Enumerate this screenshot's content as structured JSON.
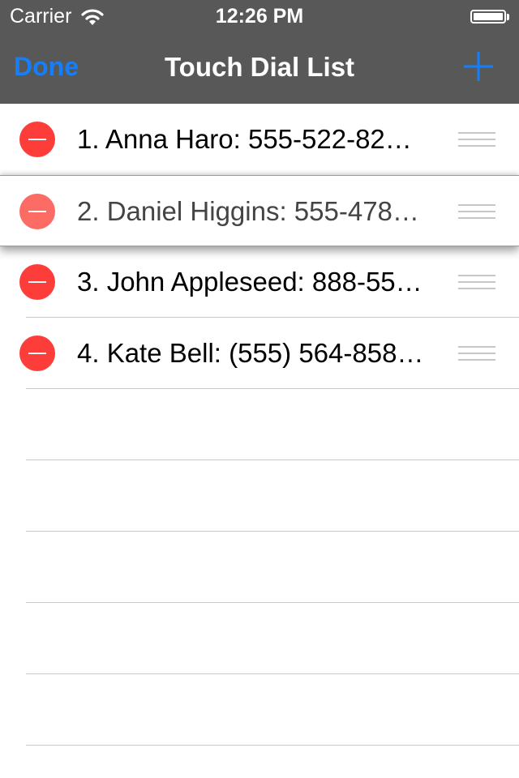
{
  "status_bar": {
    "carrier": "Carrier",
    "time": "12:26 PM",
    "wifi_icon": "wifi-icon",
    "battery_icon": "battery-icon"
  },
  "nav_bar": {
    "done_label": "Done",
    "title": "Touch Dial List",
    "add_icon": "plus-icon",
    "accent_color": "#147efb",
    "background_color": "#585858"
  },
  "rows": [
    {
      "label": "1. Anna Haro: 555-522-82…"
    },
    {
      "label": "2. Daniel Higgins: 555-478…",
      "state": "dragging"
    },
    {
      "label": "3. John Appleseed: 888-55…"
    },
    {
      "label": "4. Kate Bell: (555) 564-858…"
    }
  ],
  "colors": {
    "delete": "#fc3d39",
    "separator": "#c8c7cc"
  },
  "icons": {
    "delete": "minus-circle-icon",
    "reorder": "reorder-handle-icon"
  }
}
